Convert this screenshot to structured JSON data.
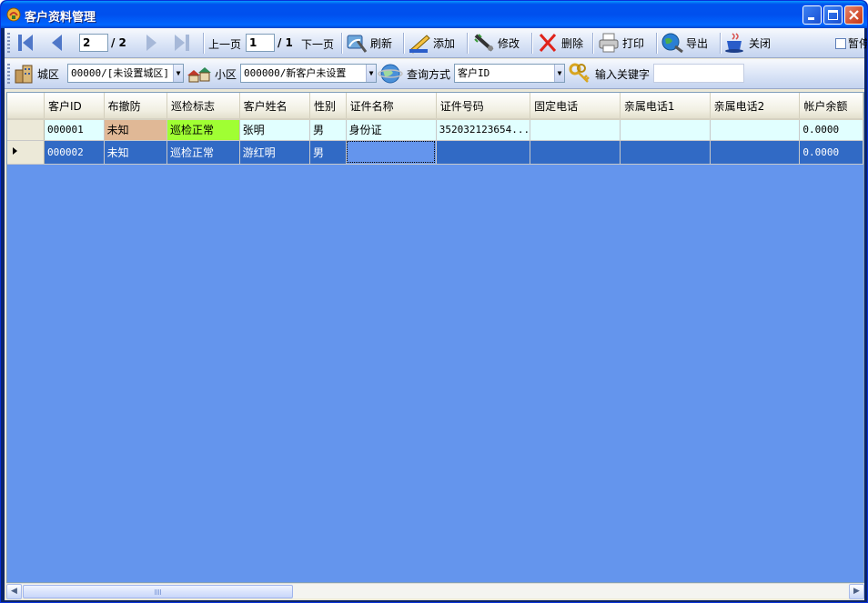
{
  "window": {
    "title": "客户资料管理"
  },
  "toolbar1": {
    "page_current": "2",
    "page_total": "/ 2",
    "prev_page": "上一页",
    "sub_page_current": "1",
    "sub_page_total": "/ 1",
    "next_page": "下一页",
    "refresh": "刷新",
    "add": "添加",
    "edit": "修改",
    "delete": "删除",
    "print": "打印",
    "export": "导出",
    "close": "关闭",
    "pause": "暂停"
  },
  "toolbar2": {
    "district_label": "城区",
    "district_value": "00000/[未设置城区]",
    "community_label": "小区",
    "community_value": "000000/新客户未设置",
    "query_mode_label": "查询方式",
    "query_mode_value": "客户ID",
    "keyword_label": "输入关键字",
    "keyword_value": ""
  },
  "table": {
    "columns": [
      "客户ID",
      "布撤防",
      "巡检标志",
      "客户姓名",
      "性别",
      "证件名称",
      "证件号码",
      "固定电话",
      "亲属电话1",
      "亲属电话2",
      "帐户余额"
    ],
    "rows": [
      [
        "000001",
        "未知",
        "巡检正常",
        "张明",
        "男",
        "身份证",
        "352032123654...",
        "",
        "",
        "",
        "0.0000"
      ],
      [
        "000002",
        "未知",
        "巡检正常",
        "游红明",
        "男",
        "",
        "",
        "",
        "",
        "",
        "0.0000"
      ]
    ]
  },
  "colors": {
    "grid_background": "#6495ed",
    "selected_row": "#316ac5",
    "row_normal": "#e1ffff",
    "status_unknown": "#e0b896",
    "status_ok": "#a0ff33"
  }
}
